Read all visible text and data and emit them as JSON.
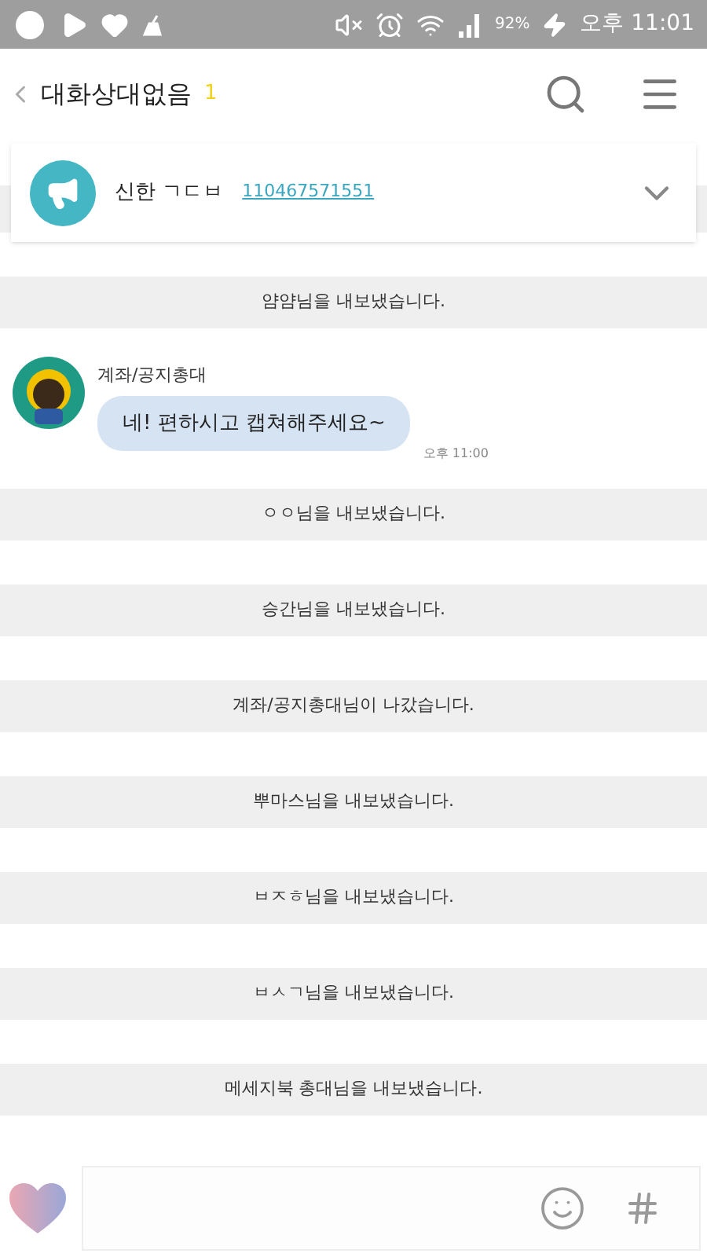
{
  "status_bar": {
    "battery_text": "92%",
    "time": "오후 11:01"
  },
  "header": {
    "title": "대화상대없음",
    "member_count": "1"
  },
  "notice": {
    "label": "신한 ㄱㄷㅂ",
    "account": "110467571551",
    "expanded": false
  },
  "messages": [
    {
      "kind": "system",
      "text": "얌얌님을 내보냈습니다."
    },
    {
      "kind": "chat",
      "sender": "계좌/공지총대",
      "text": "네! 편하시고 캡쳐해주세요~",
      "time": "오후 11:00"
    },
    {
      "kind": "system",
      "text": "ㅇㅇ님을 내보냈습니다."
    },
    {
      "kind": "system",
      "text": "승간님을 내보냈습니다."
    },
    {
      "kind": "system",
      "text": "계좌/공지총대님이 나갔습니다."
    },
    {
      "kind": "system",
      "text": "뿌마스님을 내보냈습니다."
    },
    {
      "kind": "system",
      "text": "ㅂㅈㅎ님을 내보냈습니다."
    },
    {
      "kind": "system",
      "text": "ㅂㅅㄱ님을 내보냈습니다."
    },
    {
      "kind": "system",
      "text": "메세지북 총대님을 내보냈습니다."
    }
  ]
}
